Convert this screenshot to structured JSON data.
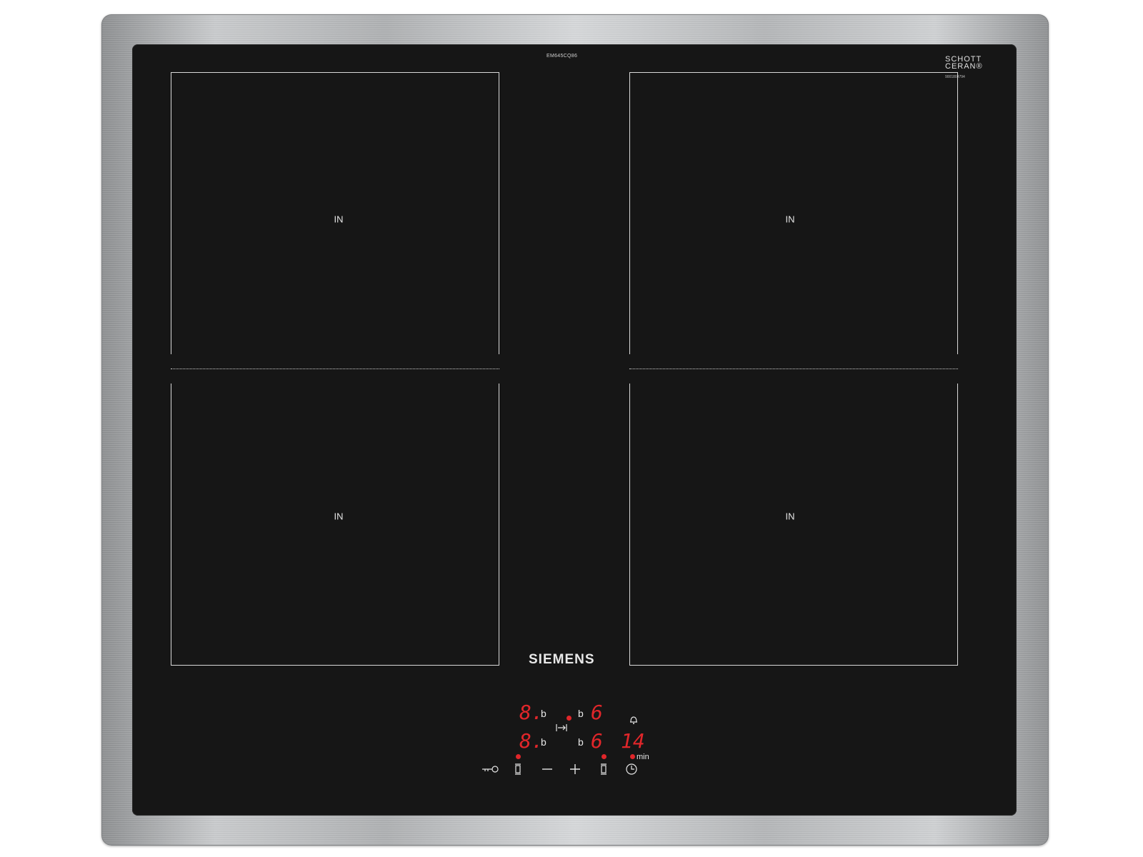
{
  "cooktop": {
    "model_code": "EM645CQ86",
    "glass_brand_line1": "SCHOTT",
    "glass_brand_line2": "CERAN",
    "serial_number": "9001804794",
    "brand": "SIEMENS",
    "zones": [
      {
        "label": "IN"
      },
      {
        "label": "IN"
      },
      {
        "label": "IN"
      },
      {
        "label": "IN"
      }
    ]
  },
  "display": {
    "front_left_level": "8.",
    "rear_left_level": "8.",
    "front_right_level": "6",
    "rear_right_level": "6",
    "left_b_top": "b",
    "left_b_bottom": "b",
    "right_b_top": "b",
    "right_b_bottom": "b",
    "timer_value": "14",
    "timer_unit": "min",
    "led_color": "#e0262a"
  },
  "controls": {
    "icons": [
      "key-lock-icon",
      "zone-select-left-icon",
      "minus-icon",
      "plus-icon",
      "zone-select-right-icon",
      "clock-icon",
      "bell-icon",
      "bridge-icon"
    ]
  }
}
